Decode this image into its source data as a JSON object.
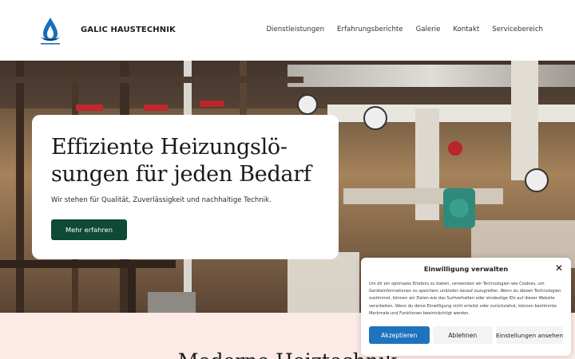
{
  "header": {
    "logo_icon": "water-drop-flame-logo",
    "brand": "GALIC HAUSTECHNIK",
    "nav": [
      "Dienstleistungen",
      "Erfahrungsberichte",
      "Galerie",
      "Kontakt",
      "Servicebereich"
    ]
  },
  "hero": {
    "title": "Effiziente Heizungslö-sungen für jeden Bedarf",
    "subtitle": "Wir stehen für Qualität, Zuverlässigkeit und nachhaltige Technik.",
    "cta": "Mehr erfahren"
  },
  "section": {
    "heading": "Moderne Heiztechnik"
  },
  "consent": {
    "title": "Einwilligung verwalten",
    "close_icon": "close-icon",
    "text": "Um dir ein optimales Erlebnis zu bieten, verwenden wir Technologien wie Cookies, um Geräteinformationen zu speichern und/oder darauf zuzugreifen. Wenn du diesen Technologien zustimmst, können wir Daten wie das Surfverhalten oder eindeutige IDs auf dieser Website verarbeiten. Wenn du deine Einwilligung nicht erteilst oder zurückziehst, können bestimmte Merkmale und Funktionen beeinträchtigt werden.",
    "accept": "Akzeptieren",
    "deny": "Ablehnen",
    "settings": "Einstellungen ansehen"
  },
  "colors": {
    "primary_button": "#0e4a35",
    "accept_button": "#1e73be",
    "section_bg": "#fbeae6"
  }
}
